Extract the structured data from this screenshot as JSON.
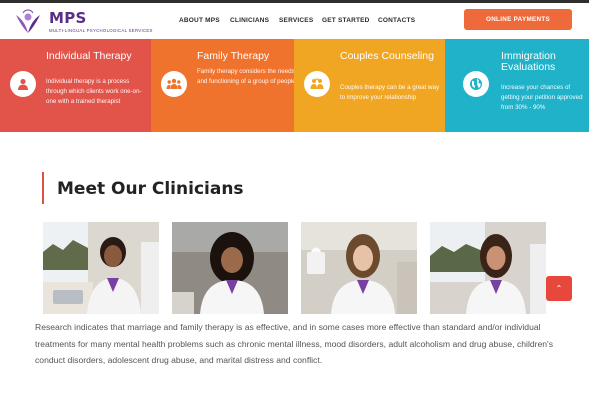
{
  "header": {
    "logo_title": "MPS",
    "logo_subtitle": "MULTI-LINGUAL PSYCHOLOGICAL SERVICES",
    "nav": [
      {
        "label": "ABOUT MPS"
      },
      {
        "label": "CLINICIANS"
      },
      {
        "label": "SERVICES"
      },
      {
        "label": "GET STARTED"
      },
      {
        "label": "CONTACTS"
      }
    ],
    "cta_label": "ONLINE PAYMENTS"
  },
  "services": [
    {
      "title": "Individual Therapy",
      "text": "Individual therapy is a process through which clients work one-on-one with a trained therapist",
      "color": "#e2534a",
      "icon": "person-icon"
    },
    {
      "title": "Family Therapy",
      "text": "Family therapy considers the needs and functioning of a group of people",
      "color": "#f0732d",
      "icon": "group-icon"
    },
    {
      "title": "Couples Counseling",
      "text": "Couples therapy can be a great way to improve your relationship",
      "color": "#f0a623",
      "icon": "couple-icon"
    },
    {
      "title": "Immigration Evaluations",
      "text": "Increase your chances of getting your petition approved from 30% - 90%",
      "color": "#1fb2c9",
      "icon": "globe-icon"
    }
  ],
  "clinicians": {
    "heading": "Meet Our Clinicians",
    "accent": "#e15045",
    "photos": [
      {
        "name": "clinician-photo-1"
      },
      {
        "name": "clinician-photo-2"
      },
      {
        "name": "clinician-photo-3"
      },
      {
        "name": "clinician-photo-4"
      }
    ]
  },
  "scroll_top_icon": "chevron-up-icon",
  "body_text": "Research indicates that marriage and family therapy is as effective, and in some cases more effective than standard and/or individual treatments for many mental health problems such as chronic mental illness, mood disorders, adult alcoholism and drug abuse, children's conduct disorders, adolescent drug abuse, and marital distress and conflict."
}
